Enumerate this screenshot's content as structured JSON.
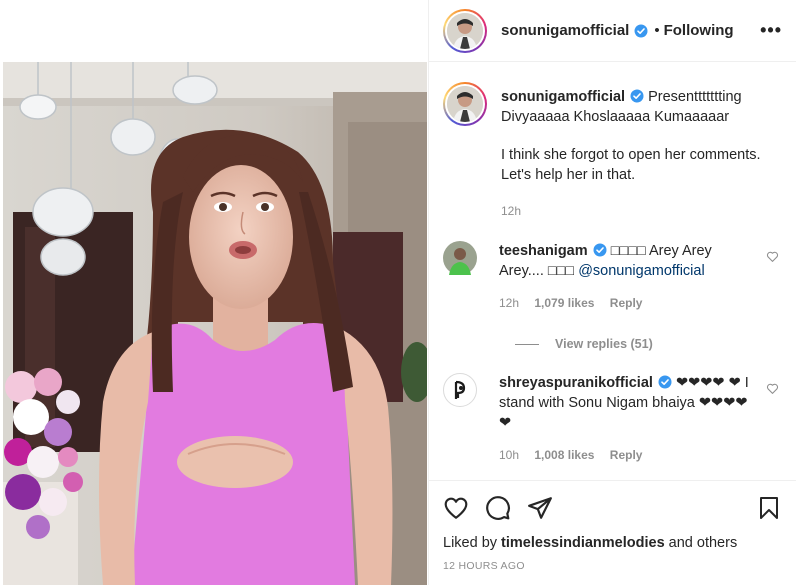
{
  "post": {
    "username": "sonunigamofficial",
    "separator": "•",
    "follow_status": "Following",
    "more": "•••"
  },
  "caption": {
    "username": "sonunigamofficial",
    "line1": "Presenttttttting Divyaaaaa Khoslaaaaa Kumaaaaar",
    "line2": "I think she forgot to open her comments. Let's help her in that.",
    "time": "12h"
  },
  "comments": [
    {
      "username": "teeshanigam",
      "text_pre": "□□□□ Arey Arey Arey.... □□□ ",
      "mention": "@sonunigamofficial",
      "time": "12h",
      "likes": "1,079 likes",
      "reply": "Reply",
      "view_replies": "View replies (51)"
    },
    {
      "username": "shreyaspuranikofficial",
      "text": "❤❤❤❤ ❤ I stand with Sonu Nigam bhaiya ❤❤❤❤❤",
      "time": "10h",
      "likes": "1,008 likes",
      "reply": "Reply"
    }
  ],
  "footer": {
    "liked_by_prefix": "Liked by",
    "liked_by_user": "timelessindianmelodies",
    "liked_by_suffix": "and others",
    "timestamp": "12 HOURS AGO"
  },
  "icons": {
    "like": "heart-icon",
    "comment": "comment-icon",
    "share": "paper-plane-icon",
    "save": "bookmark-icon",
    "verified": "verified-badge-icon"
  },
  "colors": {
    "verified": "#3897f0",
    "text": "#262626",
    "muted": "#8e8e8e",
    "mention": "#00376b"
  }
}
